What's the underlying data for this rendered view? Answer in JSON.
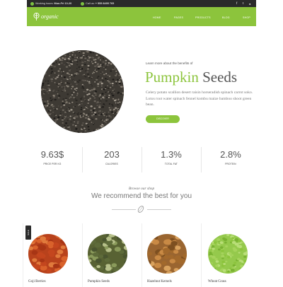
{
  "topbar": {
    "hours_label": "Working hours:",
    "hours_value": "Mon-Fri 10-20",
    "call_label": "Call us:",
    "call_value": "+ 555 8495 765",
    "social_icons": [
      "facebook-icon",
      "twitter-icon",
      "instagram-icon"
    ]
  },
  "brand": {
    "name": "organic",
    "color": "#8cc43c"
  },
  "nav": [
    "HOME",
    "PAGES",
    "PRODUCTS",
    "BLOG",
    "SHOP"
  ],
  "hero": {
    "kicker": "Learn more about the benefits of",
    "title_accent": "Pumpkin",
    "title_rest": "Seeds",
    "description": "Celery potato scallion desert raisin horseradish spinach carrot soko. Lotus root water spinach fennel kombu maize bamboo shoot green bean.",
    "button": "DISCOVER"
  },
  "stats": [
    {
      "value": "9.63$",
      "label": "PRICE PER KG"
    },
    {
      "value": "203",
      "label": "CALORIES"
    },
    {
      "value": "1.3%",
      "label": "TOTAL FAT"
    },
    {
      "value": "2.8%",
      "label": "PROTEIN"
    }
  ],
  "browse": {
    "kicker": "Browse our shop",
    "title": "We recommend the best for you"
  },
  "products": [
    {
      "name": "Goji Berries",
      "badge": "SALE"
    },
    {
      "name": "Pumpkin Seeds"
    },
    {
      "name": "Hazelnut Kernels"
    },
    {
      "name": "Wheat Grass"
    }
  ]
}
